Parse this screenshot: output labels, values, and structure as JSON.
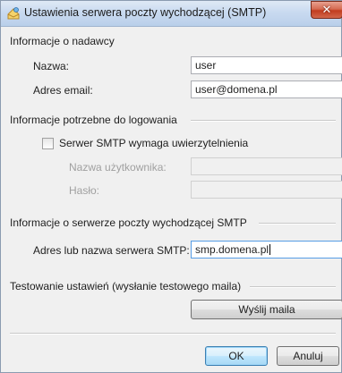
{
  "window": {
    "title": "Ustawienia serwera poczty wychodzącej (SMTP)",
    "close_glyph": "✕"
  },
  "sender": {
    "section_label": "Informacje o nadawcy",
    "name_label": "Nazwa:",
    "name_value": "user",
    "email_label": "Adres email:",
    "email_value": "user@domena.pl"
  },
  "login": {
    "section_label": "Informacje potrzebne do logowania",
    "auth_checkbox_label": "Serwer SMTP wymaga uwierzytelnienia",
    "auth_checked": false,
    "username_label": "Nazwa użytkownika:",
    "username_value": "",
    "password_label": "Hasło:",
    "password_value": ""
  },
  "server": {
    "section_label": "Informacje o serwerze poczty wychodzącej SMTP",
    "address_label": "Adres lub nazwa serwera SMTP:",
    "address_value": "smp.domena.pl"
  },
  "test": {
    "section_label": "Testowanie ustawień (wysłanie testowego maila)",
    "send_button": "Wyślij maila"
  },
  "footer": {
    "ok_button": "OK",
    "cancel_button": "Anuluj"
  },
  "colors": {
    "titlebar": "#c9daf0",
    "close_button": "#c23d1f",
    "dialog_background": "#f0f0f0",
    "default_button_border": "#3c7fb1"
  }
}
